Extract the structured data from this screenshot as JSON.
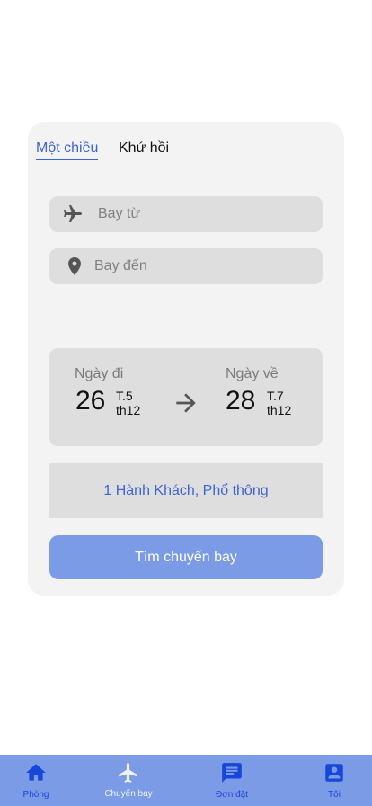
{
  "trip_tabs": {
    "one_way": "Một chiều",
    "round_trip": "Khứ hồi"
  },
  "fields": {
    "from_label": "Bay từ",
    "to_label": "Bay đến"
  },
  "dates": {
    "departure": {
      "label": "Ngày đi",
      "day": "26",
      "weekday": "T.5",
      "month": "th12"
    },
    "return": {
      "label": "Ngày về",
      "day": "28",
      "weekday": "T.7",
      "month": "th12"
    }
  },
  "passengers_text": "1 Hành Khách, Phổ thông",
  "search_button": "Tìm chuyến bay",
  "bottom_nav": [
    {
      "label": "Phòng",
      "icon": "home-icon"
    },
    {
      "label": "Chuyến bay",
      "icon": "airplane-icon"
    },
    {
      "label": "Đơn đặt",
      "icon": "message-icon"
    },
    {
      "label": "Tôi",
      "icon": "account-icon"
    }
  ],
  "colors": {
    "accent": "#3e63d6",
    "nav_background": "#7b9be6",
    "nav_active": "#1747d8",
    "button": "#7b9be6",
    "field_background": "#dedede",
    "card_background": "#f3f3f3"
  }
}
